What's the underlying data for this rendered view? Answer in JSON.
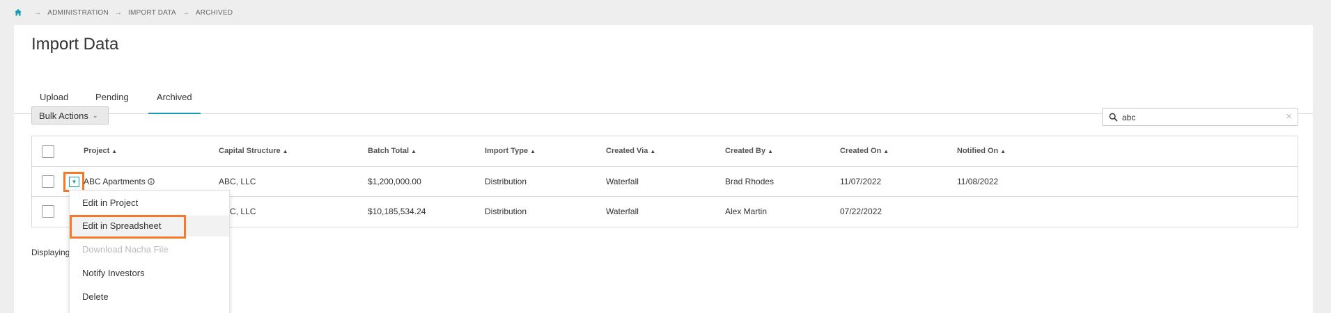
{
  "breadcrumb": {
    "items": [
      "ADMINISTRATION",
      "IMPORT DATA",
      "ARCHIVED"
    ]
  },
  "page": {
    "title": "Import Data"
  },
  "tabs": [
    {
      "label": "Upload"
    },
    {
      "label": "Pending"
    },
    {
      "label": "Archived"
    }
  ],
  "active_tab": "Archived",
  "toolbar": {
    "bulk_actions_label": "Bulk Actions"
  },
  "search": {
    "value": "abc",
    "clear": "×"
  },
  "table": {
    "columns": [
      "Project",
      "Capital Structure",
      "Batch Total",
      "Import Type",
      "Created Via",
      "Created By",
      "Created On",
      "Notified On"
    ],
    "rows": [
      {
        "project": "ABC Apartments",
        "capital_structure": "ABC, LLC",
        "batch_total": "$1,200,000.00",
        "import_type": "Distribution",
        "created_via": "Waterfall",
        "created_by": "Brad Rhodes",
        "created_on": "11/07/2022",
        "notified_on": "11/08/2022"
      },
      {
        "project": "",
        "capital_structure": "ABC, LLC",
        "batch_total": "$10,185,534.24",
        "import_type": "Distribution",
        "created_via": "Waterfall",
        "created_by": "Alex Martin",
        "created_on": "07/22/2022",
        "notified_on": ""
      }
    ]
  },
  "footer": {
    "displaying": "Displaying"
  },
  "row_menu": {
    "items": [
      {
        "label": "Edit in Project",
        "disabled": false
      },
      {
        "label": "Edit in Spreadsheet",
        "disabled": false
      },
      {
        "label": "Download Nacha File",
        "disabled": true
      },
      {
        "label": "Notify Investors",
        "disabled": false
      },
      {
        "label": "Delete",
        "disabled": false
      }
    ]
  },
  "colors": {
    "accent": "#1a9ab0",
    "highlight": "#f37a2a",
    "background": "#eeeeee"
  },
  "icons": {
    "home": "home-icon",
    "search": "search-icon",
    "info": "info-icon",
    "sort": "sort-ascending-icon",
    "toggle": "caret-down-icon"
  }
}
